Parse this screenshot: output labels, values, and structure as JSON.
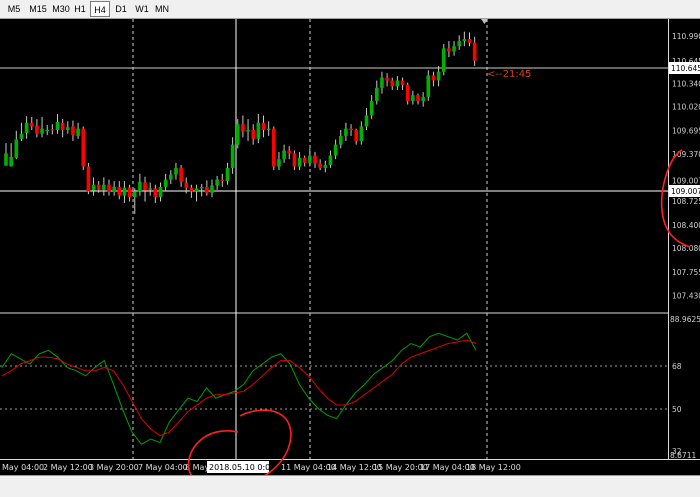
{
  "toolbar": {
    "timeframes": [
      "M5",
      "M15",
      "M30",
      "H1",
      "H4",
      "D1",
      "W1",
      "MN"
    ],
    "active": "H4"
  },
  "colors": {
    "background": "#000000",
    "grid": "#bdbdbd",
    "bull_candle": "#00b000",
    "bear_candle": "#ff0000",
    "wick": "#c8c8c8",
    "stoch_main": "#00a000",
    "stoch_signal": "#e00000",
    "annotation": "#ff2020",
    "countdown": "#d04020"
  },
  "price_panel": {
    "axis_labels": [
      "110.990",
      "110.645",
      "110.340",
      "110.020",
      "109.695",
      "109.370",
      "109.007",
      "108.725",
      "108.400",
      "108.080",
      "107.755",
      "107.430"
    ],
    "current_price_label": "110.645",
    "crosshair_price_label": "109.007",
    "countdown": "<--21:45"
  },
  "oscillator_panel": {
    "axis_labels": [
      "88.9625",
      "68",
      "50",
      "32",
      "8.6711"
    ]
  },
  "time_axis": {
    "labels": [
      "May 04:00",
      "2 May 12:00",
      "3 May 20:00",
      "7 May 04:00",
      "8 May",
      "11 May 04:00",
      "14 May 12:00",
      "15 May 20:00",
      "17 May 04:00",
      "18 May 12:00"
    ],
    "crosshair_time": "2018.05.10 0:00"
  },
  "chart_data": {
    "type": "candlestick",
    "instrument_timeframe": "H4",
    "ylim": [
      107.3,
      111.1
    ],
    "candles": [
      [
        109.21,
        109.38,
        109.3,
        109.52
      ],
      [
        109.2,
        109.33,
        109.31,
        109.52
      ],
      [
        109.32,
        109.57,
        109.3,
        109.69
      ],
      [
        109.58,
        109.65,
        109.55,
        109.8
      ],
      [
        109.66,
        109.8,
        109.58,
        109.89
      ],
      [
        109.8,
        109.75,
        109.7,
        109.88
      ],
      [
        109.76,
        109.65,
        109.6,
        109.85
      ],
      [
        109.65,
        109.72,
        109.6,
        109.88
      ],
      [
        109.7,
        109.7,
        109.63,
        109.77
      ],
      [
        109.71,
        109.7,
        109.64,
        109.78
      ],
      [
        109.7,
        109.81,
        109.65,
        109.92
      ],
      [
        109.8,
        109.7,
        109.6,
        109.85
      ],
      [
        109.7,
        109.74,
        109.65,
        109.82
      ],
      [
        109.75,
        109.63,
        109.55,
        109.83
      ],
      [
        109.62,
        109.72,
        109.58,
        109.8
      ],
      [
        109.72,
        109.2,
        109.15,
        109.75
      ],
      [
        109.2,
        108.86,
        108.82,
        109.25
      ],
      [
        108.87,
        108.95,
        108.8,
        109.05
      ],
      [
        108.95,
        108.88,
        108.84,
        109.0
      ],
      [
        108.88,
        108.95,
        108.8,
        109.05
      ],
      [
        108.95,
        108.85,
        108.8,
        109.02
      ],
      [
        108.85,
        108.92,
        108.8,
        109.0
      ],
      [
        108.92,
        108.8,
        108.75,
        109.0
      ],
      [
        108.8,
        108.91,
        108.7,
        109.0
      ],
      [
        108.91,
        108.78,
        108.72,
        108.95
      ],
      [
        108.78,
        108.86,
        108.55,
        108.9
      ],
      [
        108.86,
        108.99,
        108.8,
        109.1
      ],
      [
        108.98,
        108.87,
        108.72,
        109.06
      ],
      [
        108.88,
        108.9,
        108.8,
        108.98
      ],
      [
        108.9,
        108.78,
        108.7,
        108.95
      ],
      [
        108.78,
        108.92,
        108.72,
        108.98
      ],
      [
        108.92,
        109.02,
        108.86,
        109.1
      ],
      [
        109.02,
        109.09,
        108.96,
        109.15
      ],
      [
        109.09,
        109.18,
        109.02,
        109.25
      ],
      [
        109.18,
        108.99,
        108.92,
        109.22
      ],
      [
        108.98,
        108.91,
        108.83,
        109.05
      ],
      [
        108.91,
        108.86,
        108.77,
        108.95
      ],
      [
        108.86,
        108.9,
        108.72,
        108.95
      ],
      [
        108.9,
        108.92,
        108.79,
        108.96
      ],
      [
        108.92,
        108.84,
        108.8,
        109.01
      ],
      [
        108.84,
        108.94,
        108.78,
        109.02
      ],
      [
        108.94,
        109.02,
        108.88,
        109.07
      ],
      [
        109.02,
        109.0,
        108.92,
        109.1
      ],
      [
        109.0,
        109.18,
        108.95,
        109.25
      ],
      [
        109.18,
        109.5,
        109.1,
        109.6
      ],
      [
        109.5,
        109.78,
        109.45,
        109.85
      ],
      [
        109.78,
        109.68,
        109.6,
        109.9
      ],
      [
        109.68,
        109.7,
        109.55,
        109.85
      ],
      [
        109.7,
        109.58,
        109.5,
        109.78
      ],
      [
        109.58,
        109.8,
        109.52,
        109.92
      ],
      [
        109.8,
        109.7,
        109.6,
        109.9
      ],
      [
        109.7,
        109.72,
        109.62,
        109.82
      ],
      [
        109.72,
        109.2,
        109.15,
        109.75
      ],
      [
        109.2,
        109.3,
        109.15,
        109.4
      ],
      [
        109.3,
        109.42,
        109.25,
        109.5
      ],
      [
        109.42,
        109.38,
        109.3,
        109.48
      ],
      [
        109.38,
        109.2,
        109.15,
        109.42
      ],
      [
        109.2,
        109.32,
        109.15,
        109.4
      ],
      [
        109.32,
        109.25,
        109.2,
        109.35
      ],
      [
        109.25,
        109.35,
        109.2,
        109.45
      ],
      [
        109.35,
        109.24,
        109.18,
        109.4
      ],
      [
        109.24,
        109.18,
        109.15,
        109.3
      ],
      [
        109.18,
        109.22,
        109.12,
        109.28
      ],
      [
        109.22,
        109.35,
        109.18,
        109.42
      ],
      [
        109.35,
        109.5,
        109.3,
        109.57
      ],
      [
        109.5,
        109.62,
        109.45,
        109.7
      ],
      [
        109.62,
        109.72,
        109.55,
        109.8
      ],
      [
        109.72,
        109.7,
        109.62,
        109.78
      ],
      [
        109.7,
        109.55,
        109.5,
        109.72
      ],
      [
        109.55,
        109.75,
        109.5,
        109.82
      ],
      [
        109.75,
        109.9,
        109.7,
        110.0
      ],
      [
        109.9,
        110.1,
        109.85,
        110.18
      ],
      [
        110.1,
        110.28,
        110.05,
        110.38
      ],
      [
        110.28,
        110.42,
        110.2,
        110.5
      ],
      [
        110.42,
        110.38,
        110.3,
        110.48
      ],
      [
        110.38,
        110.3,
        110.25,
        110.42
      ],
      [
        110.3,
        110.38,
        110.25,
        110.44
      ],
      [
        110.38,
        110.32,
        110.25,
        110.42
      ],
      [
        110.32,
        110.1,
        110.05,
        110.35
      ],
      [
        110.1,
        110.18,
        110.05,
        110.24
      ],
      [
        110.18,
        110.1,
        110.05,
        110.2
      ],
      [
        110.1,
        110.15,
        110.02,
        110.22
      ],
      [
        110.15,
        110.45,
        110.1,
        110.52
      ],
      [
        110.45,
        110.38,
        110.3,
        110.5
      ],
      [
        110.38,
        110.5,
        110.3,
        110.58
      ],
      [
        110.5,
        110.82,
        110.45,
        110.88
      ],
      [
        110.82,
        110.78,
        110.7,
        110.92
      ],
      [
        110.78,
        110.85,
        110.72,
        110.92
      ],
      [
        110.85,
        110.92,
        110.8,
        111.0
      ],
      [
        110.92,
        110.95,
        110.85,
        111.05
      ],
      [
        110.95,
        110.9,
        110.85,
        111.04
      ],
      [
        110.9,
        110.65,
        110.58,
        110.98
      ]
    ],
    "stochastic": {
      "ylim": [
        8.6711,
        88.9625
      ],
      "main": [
        60,
        68,
        65,
        62,
        68,
        70,
        66,
        60,
        58,
        55,
        60,
        64,
        50,
        35,
        22,
        15,
        18,
        16,
        28,
        35,
        42,
        40,
        48,
        42,
        44,
        46,
        50,
        58,
        62,
        66,
        68,
        62,
        50,
        42,
        36,
        32,
        30,
        38,
        45,
        50,
        56,
        60,
        64,
        70,
        74,
        72,
        78,
        80,
        78,
        76,
        80,
        70
      ],
      "signal": [
        55,
        58,
        62,
        64,
        66,
        66,
        65,
        62,
        60,
        58,
        58,
        60,
        58,
        50,
        40,
        30,
        24,
        20,
        22,
        28,
        34,
        38,
        42,
        44,
        44,
        45,
        46,
        50,
        55,
        60,
        64,
        64,
        60,
        55,
        48,
        42,
        38,
        38,
        40,
        44,
        48,
        52,
        56,
        62,
        66,
        68,
        70,
        72,
        74,
        75,
        76,
        74
      ]
    }
  }
}
